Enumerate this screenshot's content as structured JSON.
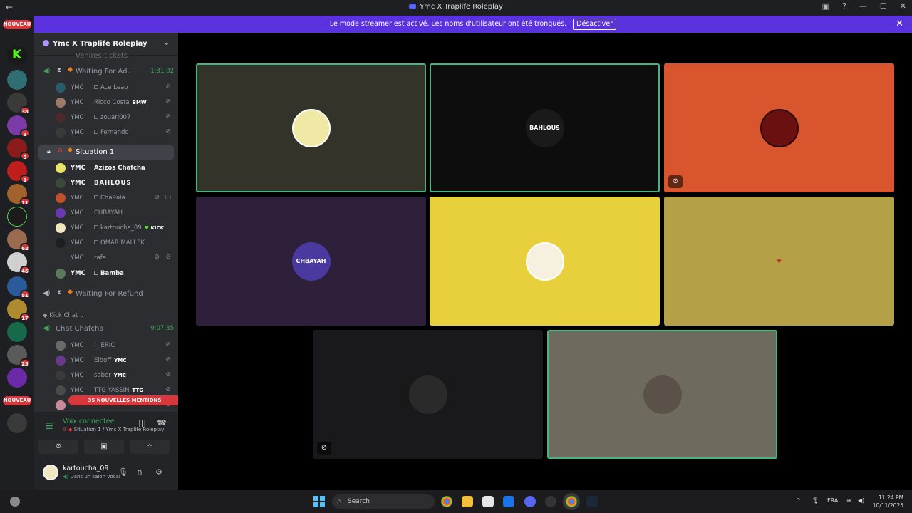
{
  "window": {
    "title": "Ymc X Traplife Roleplay",
    "controls": [
      "minimize-icon",
      "maximize-icon",
      "close-icon"
    ]
  },
  "banner": {
    "text": "Le mode streamer est activé. Les noms d'utilisateur ont été tronqués.",
    "button": "Désactiver"
  },
  "guilds": {
    "nouveau_top": "NOUVEAU",
    "nouveau_bottom": "NOUVEAU",
    "badges": [
      "38",
      "3",
      "9",
      "1",
      "11",
      "62",
      "46",
      "51",
      "17",
      "23"
    ]
  },
  "sidebar": {
    "server_name": "Ymc X Traplife Roleplay",
    "truncated_channel": "Venires-tickets",
    "channels": [
      {
        "name": "Waiting For Ad...",
        "timer": "1:31:02"
      },
      {
        "name": "Situation 1"
      },
      {
        "name": "Waiting For Refund"
      },
      {
        "name": "Chat Chafcha",
        "timer": "9:07:35"
      }
    ],
    "category": "Kick Chat",
    "waiting_users": [
      {
        "tag": "YMC",
        "name": "Ace Leao"
      },
      {
        "tag": "YMC",
        "name": "Ricco Costa",
        "extra": "BMW"
      },
      {
        "tag": "YMC",
        "name": "zouari007"
      },
      {
        "tag": "YMC",
        "name": "Fernando"
      }
    ],
    "situation_users": [
      {
        "tag": "YMC",
        "name": "Azizos Chafcha"
      },
      {
        "tag": "YMC",
        "name": "BAHLOUS"
      },
      {
        "tag": "YMC",
        "name": "Cha9ala"
      },
      {
        "tag": "YMC",
        "name": "CHBAYAH"
      },
      {
        "tag": "YMC",
        "name": "kartoucha_09",
        "extra": "KICK"
      },
      {
        "tag": "YMC",
        "name": "OMAR MALLEK"
      },
      {
        "tag": "YMC",
        "name": "rafa"
      },
      {
        "tag": "YMC",
        "name": "Bamba"
      }
    ],
    "chat_users": [
      {
        "tag": "YMC",
        "name": "I_ ERIC"
      },
      {
        "tag": "YMC",
        "name": "Elboff",
        "extra": "YMC"
      },
      {
        "tag": "YMC",
        "name": "saber",
        "extra": "YMC"
      },
      {
        "tag": "YMC",
        "name": "TTG YASSIN",
        "extra": "TTG"
      }
    ],
    "mentions": "35 NOUVELLES MENTIONS"
  },
  "voice": {
    "status": "Voix connectée",
    "location": "Situation 1 / Ymc X Traplife Roleplay"
  },
  "user": {
    "name": "kartoucha_09",
    "status": "Dans un salon vocal"
  },
  "tiles": [
    {
      "label": "",
      "color": "#33332a"
    },
    {
      "label": "BAHLOUS",
      "color": "#0d0d0d"
    },
    {
      "label": "",
      "color": "#d9552e"
    },
    {
      "label": "CHBAYAH",
      "color": "#2e1f3a"
    },
    {
      "label": "",
      "color": "#e8cf3c"
    },
    {
      "label": "",
      "color": "#b3a047"
    },
    {
      "label": "",
      "color": "#19191b"
    },
    {
      "label": "",
      "color": "#6f6a5e"
    }
  ],
  "taskbar": {
    "search": "Search",
    "lang": "FRA",
    "time": "11:24 PM",
    "date": "10/11/2025"
  }
}
